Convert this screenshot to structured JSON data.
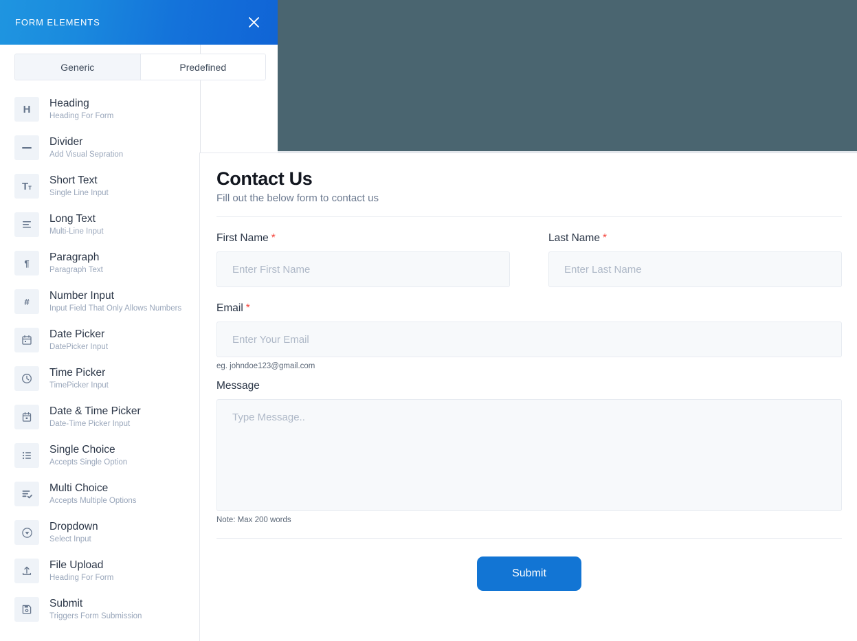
{
  "panel": {
    "title": "FORM ELEMENTS",
    "close_icon": "close-icon",
    "tabs": [
      {
        "label": "Generic",
        "active": true
      },
      {
        "label": "Predefined",
        "active": false
      }
    ],
    "elements": [
      {
        "title": "Heading",
        "desc": "Heading For Form",
        "icon": "heading-icon"
      },
      {
        "title": "Divider",
        "desc": "Add Visual Sepration",
        "icon": "divider-icon"
      },
      {
        "title": "Short Text",
        "desc": "Single Line Input",
        "icon": "short-text-icon"
      },
      {
        "title": "Long Text",
        "desc": "Multi-Line Input",
        "icon": "long-text-icon"
      },
      {
        "title": "Paragraph",
        "desc": "Paragraph Text",
        "icon": "paragraph-icon"
      },
      {
        "title": "Number Input",
        "desc": "Input Field That Only Allows Numbers",
        "icon": "number-icon"
      },
      {
        "title": "Date Picker",
        "desc": "DatePicker Input",
        "icon": "calendar-icon"
      },
      {
        "title": "Time Picker",
        "desc": "TimePicker Input",
        "icon": "clock-icon"
      },
      {
        "title": "Date & Time Picker",
        "desc": "Date-Time Picker Input",
        "icon": "calendar-clock-icon"
      },
      {
        "title": "Single Choice",
        "desc": "Accepts Single Option",
        "icon": "list-icon"
      },
      {
        "title": "Multi Choice",
        "desc": "Accepts Multiple Options",
        "icon": "list-check-icon"
      },
      {
        "title": "Dropdown",
        "desc": "Select Input",
        "icon": "chevron-down-circle-icon"
      },
      {
        "title": "File Upload",
        "desc": "Heading For Form",
        "icon": "upload-icon"
      },
      {
        "title": "Submit",
        "desc": "Triggers Form Submission",
        "icon": "save-icon"
      }
    ]
  },
  "form": {
    "title": "Contact Us",
    "subtitle": "Fill out the below form to contact us",
    "first_name": {
      "label": "First Name",
      "required": "*",
      "value": "",
      "placeholder": "Enter First Name"
    },
    "last_name": {
      "label": "Last Name",
      "required": "*",
      "value": "",
      "placeholder": "Enter Last Name"
    },
    "email": {
      "label": "Email",
      "required": "*",
      "value": "",
      "placeholder": "Enter Your Email",
      "hint": "eg. johndoe123@gmail.com"
    },
    "message": {
      "label": "Message",
      "value": "",
      "placeholder": "Type Message..",
      "hint": "Note:  Max 200 words"
    },
    "submit_label": "Submit"
  },
  "colors": {
    "header_gradient_start": "#1f95e0",
    "header_gradient_end": "#1064d6",
    "backdrop": "#4a6570",
    "accent": "#1275d4",
    "required": "#f4453c",
    "icon_tile": "#eff3f8",
    "input_bg": "#f7f9fb"
  }
}
